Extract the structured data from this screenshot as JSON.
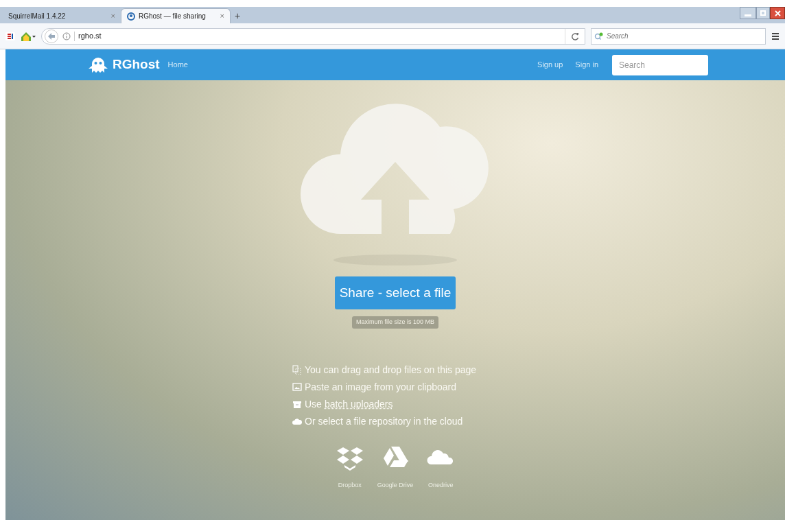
{
  "browser": {
    "tabs": [
      {
        "label": "SquirrelMail 1.4.22",
        "close": "×",
        "selected": false
      },
      {
        "label": "RGhost — file sharing",
        "close": "×",
        "selected": true
      }
    ],
    "new_tab": "+",
    "address": "rgho.st",
    "search": {
      "placeholder": "Search"
    }
  },
  "navbar": {
    "brand": "RGhost",
    "links": [
      "Home"
    ],
    "right_links": [
      "Sign up",
      "Sign in"
    ],
    "search": {
      "placeholder": "Search"
    }
  },
  "upload": {
    "button": "Share - select a file",
    "limit": "Maximum file size is 100 MB"
  },
  "hints": [
    {
      "kind": "drag",
      "text": "You can drag and drop files on this page"
    },
    {
      "kind": "paste",
      "text": "Paste an image from your clipboard"
    },
    {
      "kind": "batch",
      "text": "Use",
      "link": "batch uploaders"
    },
    {
      "kind": "cloud",
      "text": "Or select a file repository in the cloud"
    }
  ],
  "services": [
    {
      "kind": "dropbox",
      "label": "Dropbox"
    },
    {
      "kind": "drive",
      "label": "Google Drive"
    },
    {
      "kind": "onedrive",
      "label": "Onedrive"
    }
  ]
}
